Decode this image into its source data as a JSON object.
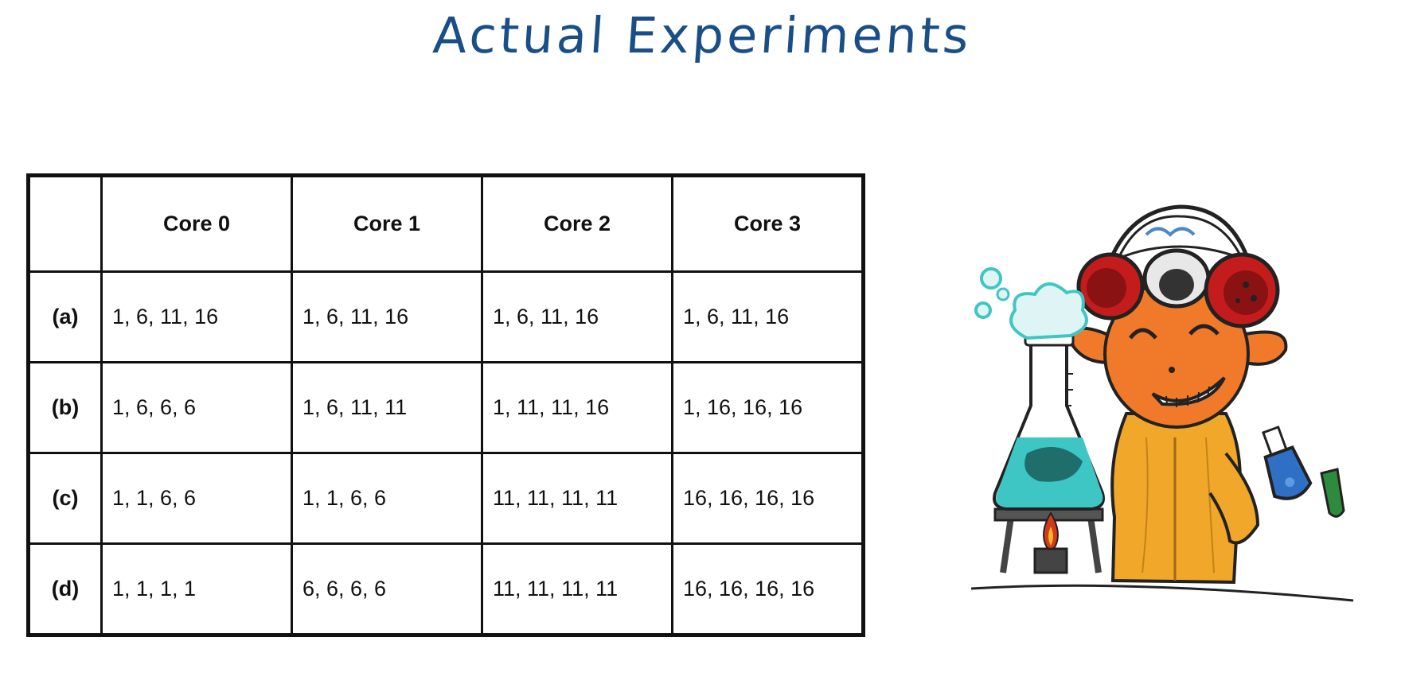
{
  "title": "Actual Experiments",
  "table": {
    "headers": [
      "",
      "Core 0",
      "Core 1",
      "Core 2",
      "Core 3"
    ],
    "rows": [
      {
        "label": "(a)",
        "cells": [
          "1, 6, 11, 16",
          "1, 6, 11, 16",
          "1, 6, 11, 16",
          "1, 6, 11, 16"
        ]
      },
      {
        "label": "(b)",
        "cells": [
          "1, 6, 6, 6",
          "1, 6, 11, 11",
          "1, 11, 11, 16",
          "1, 16, 16, 16"
        ]
      },
      {
        "label": "(c)",
        "cells": [
          "1, 1, 6, 6",
          "1, 1, 6, 6",
          "11, 11, 11, 11",
          "16, 16, 16, 16"
        ]
      },
      {
        "label": "(d)",
        "cells": [
          "1, 1, 1, 1",
          "6, 6, 6, 6",
          "11, 11, 11, 11",
          "16, 16, 16, 16"
        ]
      }
    ]
  },
  "illustration": {
    "icon": "scientist-with-flask-icon",
    "colors": {
      "skin": "#f07a2a",
      "suit": "#f0a72a",
      "liquid": "#3ec6c4",
      "goggles": "#c41c1c",
      "flask_small": "#2f6fc4"
    }
  }
}
